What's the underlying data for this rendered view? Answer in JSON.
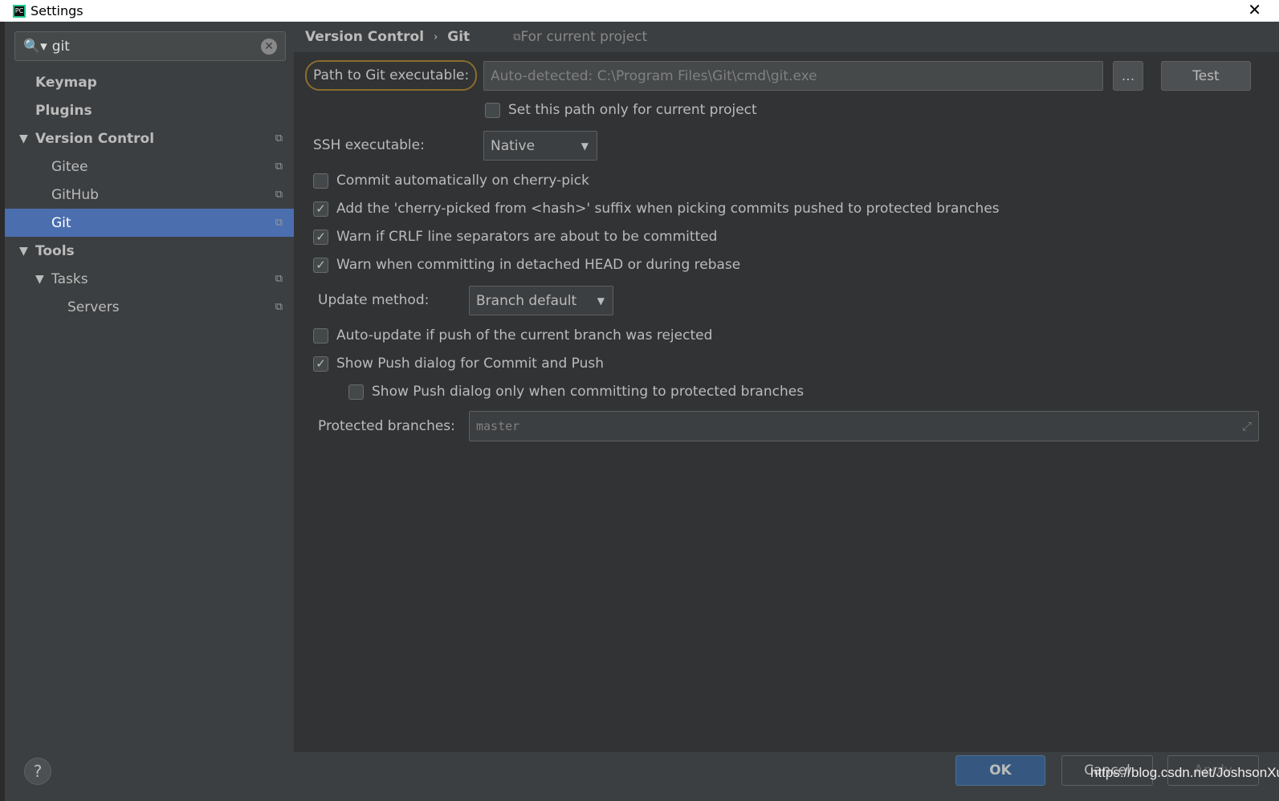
{
  "window": {
    "title": "Settings",
    "close": "✕"
  },
  "search": {
    "value": "git",
    "icon": "search-icon",
    "clear": "✕"
  },
  "tree": [
    {
      "label": "Keymap",
      "bold": true,
      "level": 0
    },
    {
      "label": "Plugins",
      "bold": true,
      "level": 0
    },
    {
      "label": "Version Control",
      "bold": true,
      "level": 0,
      "expanded": true,
      "copy": true
    },
    {
      "label": "Gitee",
      "level": 1,
      "copy": true
    },
    {
      "label": "GitHub",
      "level": 1,
      "copy": true
    },
    {
      "label": "Git",
      "level": 1,
      "copy": true,
      "selected": true
    },
    {
      "label": "Tools",
      "bold": true,
      "level": 0,
      "expanded": true
    },
    {
      "label": "Tasks",
      "level": 1,
      "expanded": true,
      "copy": true
    },
    {
      "label": "Servers",
      "level": 2,
      "copy": true
    }
  ],
  "breadcrumb": {
    "parent": "Version Control",
    "sep": "›",
    "current": "Git",
    "scope": "For current project"
  },
  "git": {
    "path_label": "Path to Git executable:",
    "path_placeholder": "Auto-detected: C:\\Program Files\\Git\\cmd\\git.exe",
    "browse": "...",
    "test": "Test",
    "path_only_current": "Set this path only for current project",
    "ssh_label": "SSH executable:",
    "ssh_value": "Native",
    "opt_cherry": "Commit automatically on cherry-pick",
    "opt_suffix": "Add the 'cherry-picked from <hash>' suffix when picking commits pushed to protected branches",
    "opt_crlf": "Warn if CRLF line separators are about to be committed",
    "opt_detached": "Warn when committing in detached HEAD or during rebase",
    "update_label": "Update method:",
    "update_value": "Branch default",
    "opt_autoupdate": "Auto-update if push of the current branch was rejected",
    "opt_showpush": "Show Push dialog for Commit and Push",
    "opt_showpush_protected": "Show Push dialog only when committing to protected branches",
    "protected_label": "Protected branches:",
    "protected_value": "master"
  },
  "footer": {
    "help": "?",
    "ok": "OK",
    "cancel": "Cancel",
    "apply": "Apply",
    "watermark": "https://blog.csdn.net/JoshsonXu"
  },
  "colors": {
    "selection": "#4b6eaf",
    "ok": "#365880",
    "focus": "#8a6d2b"
  }
}
